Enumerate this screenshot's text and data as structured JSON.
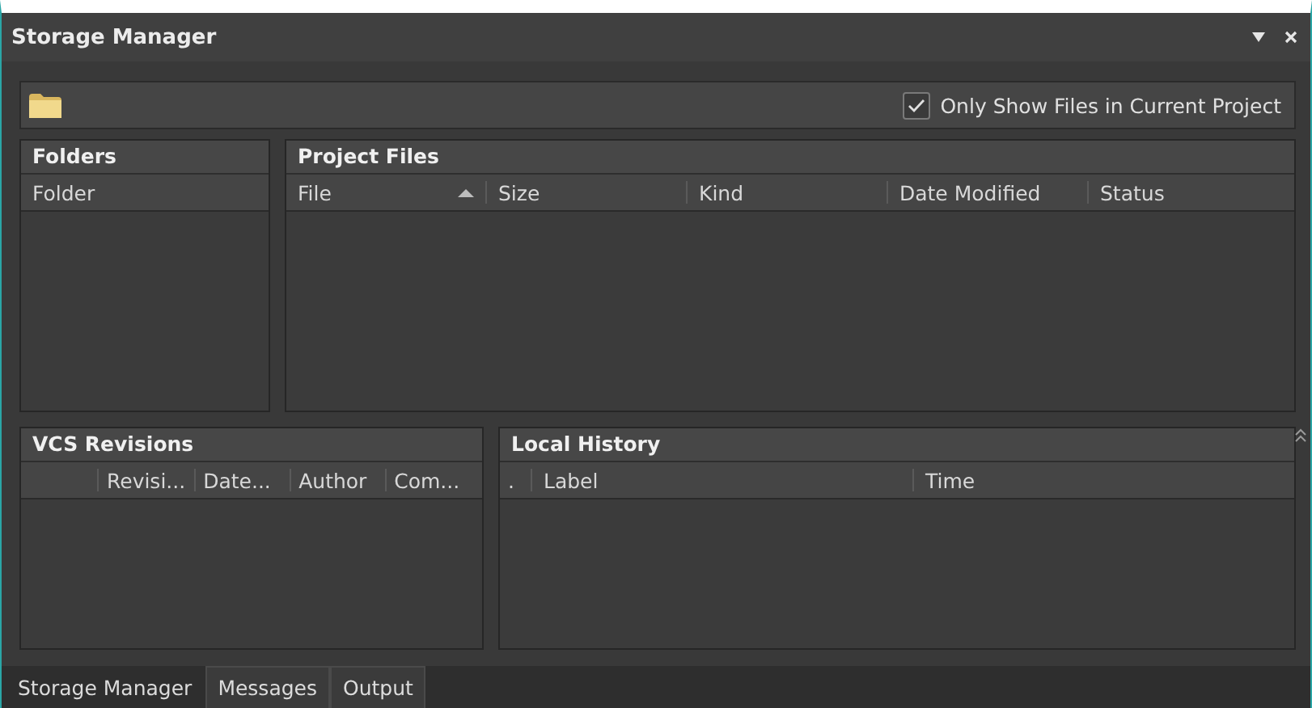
{
  "window": {
    "title": "Storage Manager"
  },
  "toolbar": {
    "checkbox": {
      "label": "Only Show Files in Current Project",
      "checked": true
    }
  },
  "folders": {
    "title": "Folders",
    "columns": [
      {
        "label": "Folder",
        "sorted": false
      }
    ]
  },
  "project_files": {
    "title": "Project Files",
    "columns": [
      {
        "label": "File",
        "sorted": true
      },
      {
        "label": "Size",
        "sorted": false
      },
      {
        "label": "Kind",
        "sorted": false
      },
      {
        "label": "Date Modified",
        "sorted": false
      },
      {
        "label": "Status",
        "sorted": false
      }
    ]
  },
  "vcs_revisions": {
    "title": "VCS Revisions",
    "columns": [
      {
        "label": "Revisi...",
        "sorted": false
      },
      {
        "label": "Date...",
        "sorted": false
      },
      {
        "label": "Author",
        "sorted": false
      },
      {
        "label": "Com...",
        "sorted": false
      }
    ]
  },
  "local_history": {
    "title": "Local History",
    "columns": [
      {
        "label": ".",
        "sorted": false
      },
      {
        "label": "Label",
        "sorted": false
      },
      {
        "label": "Time",
        "sorted": false
      }
    ]
  },
  "tabs": [
    {
      "label": "Storage Manager",
      "selected": true
    },
    {
      "label": "Messages",
      "selected": false
    },
    {
      "label": "Output",
      "selected": false
    }
  ]
}
